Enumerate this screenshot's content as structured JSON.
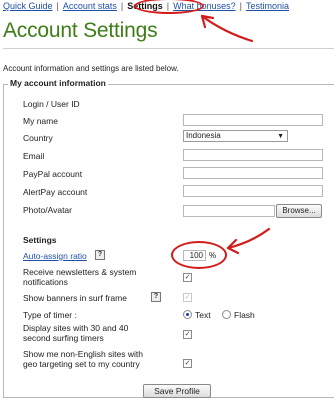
{
  "nav": {
    "items": [
      "Quick Guide",
      "Account stats",
      "Settings",
      "What bonuses?",
      "Testimonia"
    ],
    "separator": "|"
  },
  "page": {
    "title": "Account Settings",
    "intro": "Account information and settings are listed below."
  },
  "account": {
    "legend": "My account information",
    "login_label": "Login / User ID",
    "login_value": "",
    "name_label": "My name",
    "country_label": "Country",
    "country_value": "Indonesia",
    "email_label": "Email",
    "paypal_label": "PayPal account",
    "alertpay_label": "AlertPay account",
    "photo_label": "Photo/Avatar",
    "browse_label": "Browse..."
  },
  "settings": {
    "header": "Settings",
    "auto_assign_label": "Auto-assign ratio",
    "auto_assign_value": "100",
    "percent": "%",
    "help": "?",
    "newsletter_label": "Receive newsletters & system notifications",
    "banners_label": "Show banners in surf frame",
    "timer_label": "Type of timer :",
    "timer_text": "Text",
    "timer_flash": "Flash",
    "display_sites_label": "Display sites with 30 and 40 second surfing timers",
    "non_english_label": "Show me non-English sites with geo targeting set to my country",
    "save_label": "Save Profile",
    "check_mark": "✓"
  },
  "colors": {
    "title_green": "#3e7d18",
    "link_blue": "#1f4fa8",
    "annotation_red": "#d41a1a"
  }
}
